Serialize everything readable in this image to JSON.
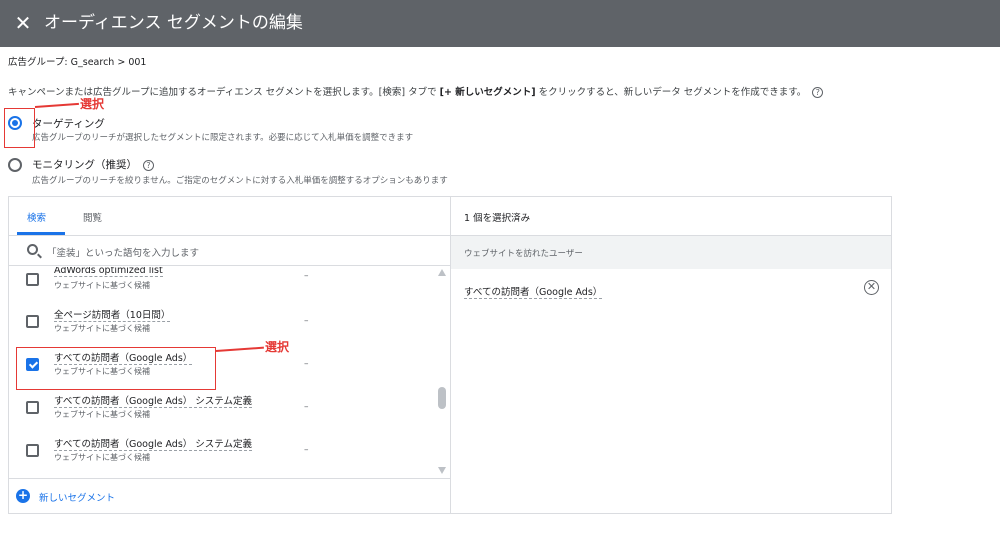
{
  "header": {
    "title": "オーディエンス セグメントの編集",
    "close_glyph": "✕"
  },
  "breadcrumb": "広告グループ: G_search > 001",
  "description": {
    "part1": "キャンペーンまたは広告グループに追加するオーディエンス セグメントを選択します。[検索] タブで ",
    "bold": "[+ 新しいセグメント]",
    "part2": " をクリックすると、新しいデータ セグメントを作成できます。"
  },
  "options": [
    {
      "label": "ターゲティング",
      "sub": "広告グループのリーチが選択したセグメントに限定されます。必要に応じて入札単価を調整できます",
      "selected": true
    },
    {
      "label": "モニタリング（推奨）",
      "sub": "広告グループのリーチを絞りません。ご指定のセグメントに対する入札単価を調整するオプションもあります",
      "selected": false
    }
  ],
  "annotation_label": "選択",
  "tabs": [
    {
      "label": "検索",
      "active": true
    },
    {
      "label": "閲覧",
      "active": false
    }
  ],
  "search": {
    "placeholder": "「塗装」といった語句を入力します"
  },
  "list_items": [
    {
      "name": "AdWords optimized list",
      "type": "ウェブサイトに基づく候補",
      "dash": "–",
      "checked": false
    },
    {
      "name": "全ページ訪問者（10日間）",
      "type": "ウェブサイトに基づく候補",
      "dash": "–",
      "checked": false
    },
    {
      "name": "すべての訪問者（Google Ads）",
      "type": "ウェブサイトに基づく候補",
      "dash": "–",
      "checked": true
    },
    {
      "name": "すべての訪問者（Google Ads） システム定義",
      "type": "ウェブサイトに基づく候補",
      "dash": "–",
      "checked": false
    },
    {
      "name": "すべての訪問者（Google Ads） システム定義",
      "type": "ウェブサイトに基づく候補",
      "dash": "–",
      "checked": false
    }
  ],
  "new_segment": {
    "label": "新しいセグメント",
    "glyph": "+"
  },
  "selected_panel": {
    "count": "1 個を選択済み",
    "group_header": "ウェブサイトを訪れたユーザー",
    "item": "すべての訪問者（Google Ads）",
    "remove_glyph": "✕"
  },
  "help_glyph": "?",
  "colors": {
    "accent": "#1a73e8",
    "header_bg": "#5f6368",
    "annotation": "#e53935"
  }
}
